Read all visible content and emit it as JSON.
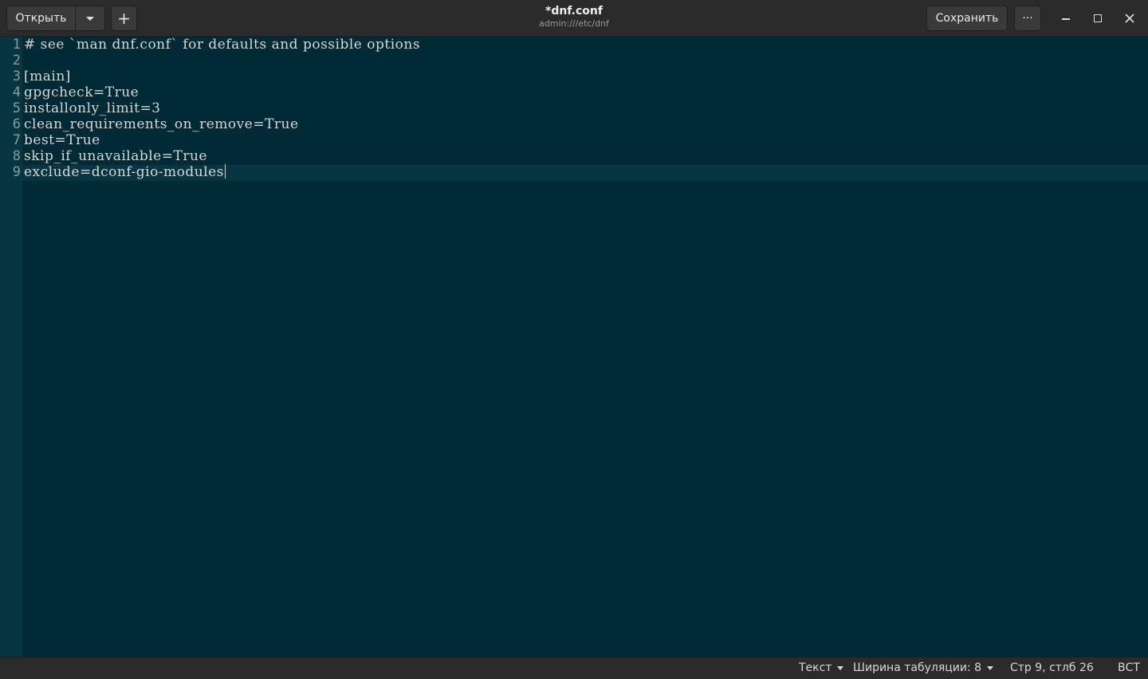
{
  "header": {
    "open_label": "Открыть",
    "save_label": "Сохранить",
    "more_label": "···",
    "title": "*dnf.conf",
    "subtitle": "admin:///etc/dnf"
  },
  "editor": {
    "lines": [
      {
        "num": "1",
        "text": "# see `man dnf.conf` for defaults and possible options"
      },
      {
        "num": "2",
        "text": ""
      },
      {
        "num": "3",
        "text": "[main]"
      },
      {
        "num": "4",
        "text": "gpgcheck=True"
      },
      {
        "num": "5",
        "text": "installonly_limit=3"
      },
      {
        "num": "6",
        "text": "clean_requirements_on_remove=True"
      },
      {
        "num": "7",
        "text": "best=True"
      },
      {
        "num": "8",
        "text": "skip_if_unavailable=True"
      },
      {
        "num": "9",
        "text": "exclude=dconf-gio-modules"
      }
    ],
    "current_line": 9
  },
  "statusbar": {
    "language": "Текст",
    "tab_width": "Ширина табуляции: 8",
    "position": "Стр 9, стлб 26",
    "mode": "ВСТ"
  },
  "colors": {
    "background": "#002b36",
    "gutter": "#073642",
    "text": "#d4d8d4",
    "headerbar": "#2b2b2b"
  }
}
